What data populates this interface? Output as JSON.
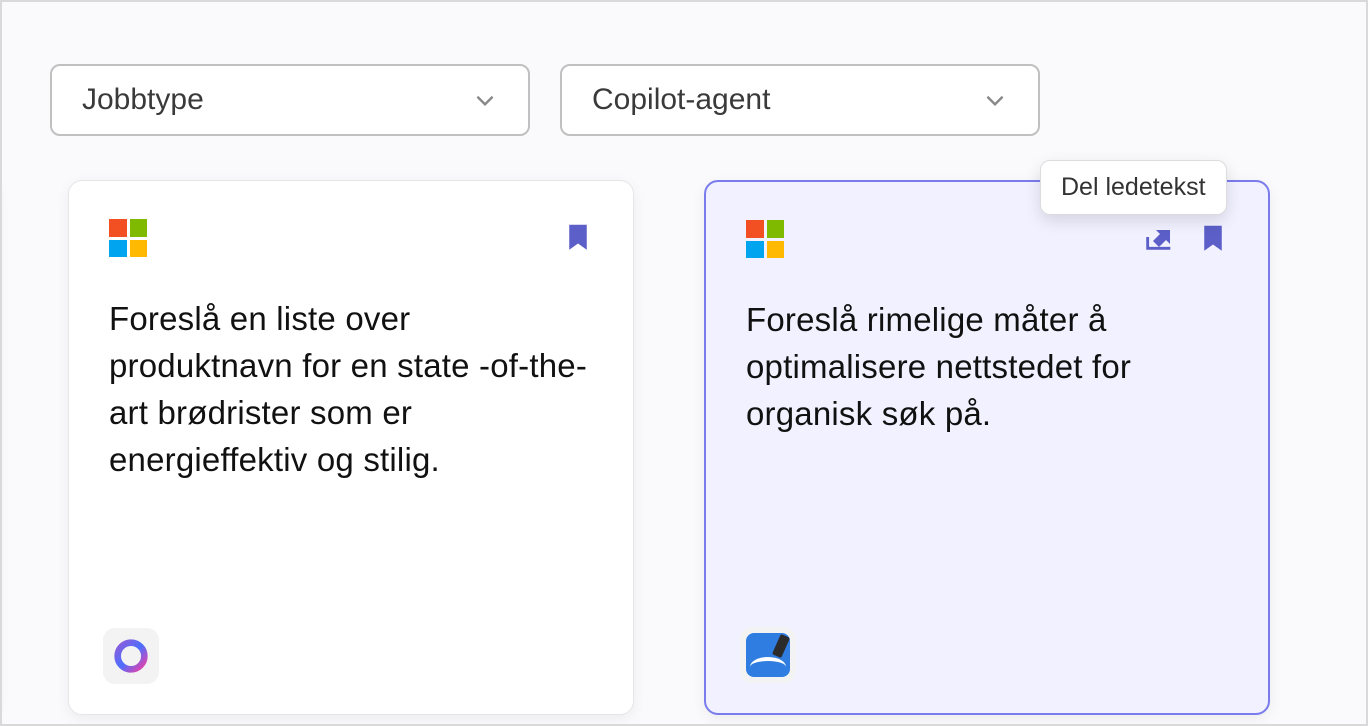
{
  "filters": {
    "jobtype_label": "Jobbtype",
    "agent_label": "Copilot-agent"
  },
  "tooltip": {
    "share_prompt": "Del ledetekst"
  },
  "cards": {
    "left": {
      "text": "Foreslå en liste over produktnavn for en state -of-the-art brødrister som er energieffektiv og stilig.",
      "source_icon": "microsoft-logo",
      "app_icon": "loop-icon"
    },
    "right": {
      "text": "Foreslå rimelige måter å optimalisere nettstedet for organisk søk på.",
      "source_icon": "microsoft-logo",
      "app_icon": "whiteboard-icon"
    }
  }
}
